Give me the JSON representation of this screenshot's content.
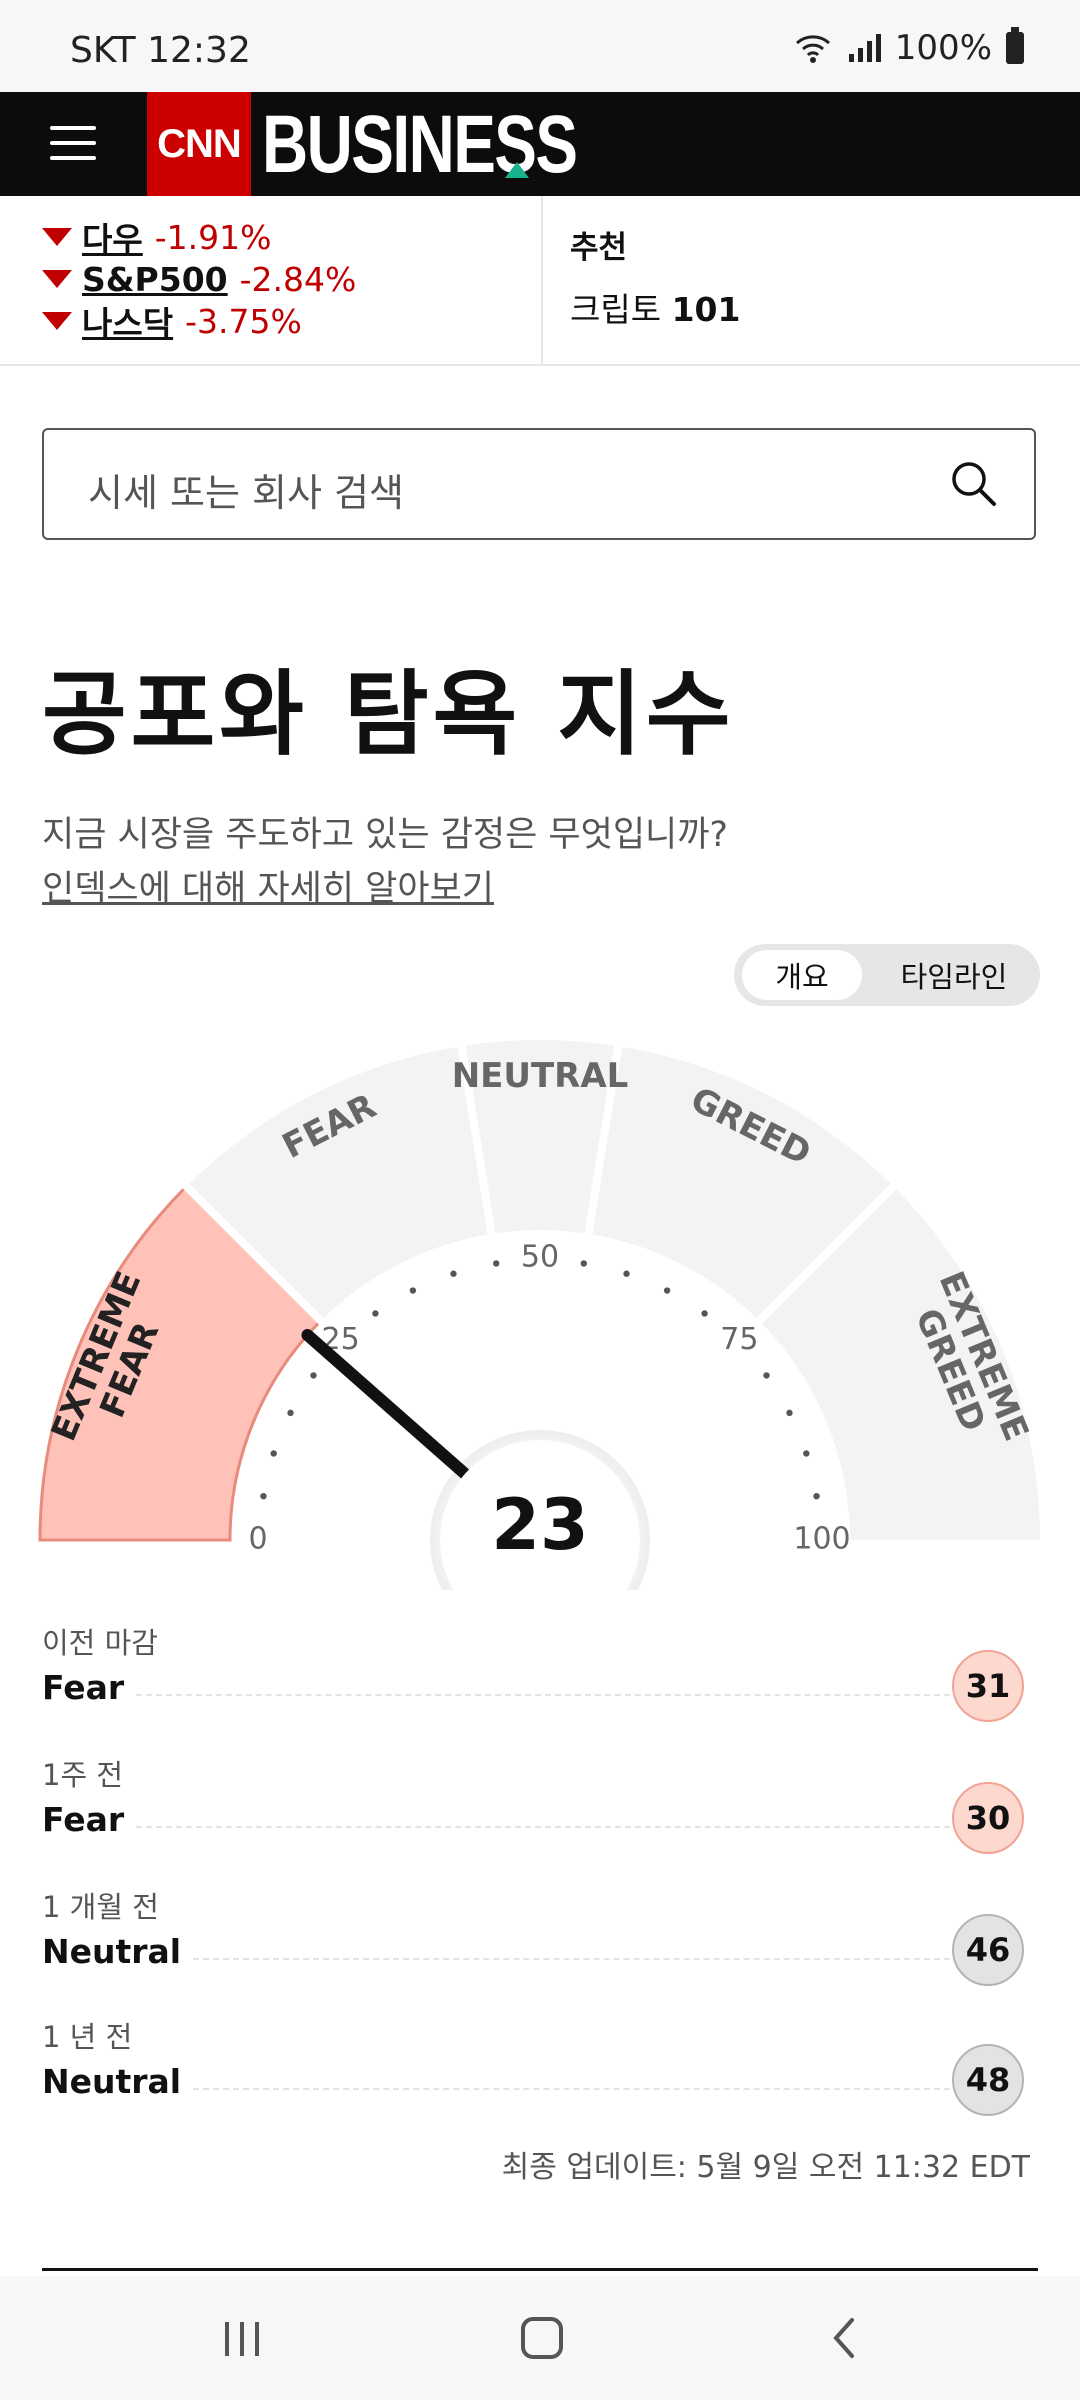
{
  "status_bar": {
    "carrier": "SKT 12:32",
    "battery": "100%"
  },
  "header": {
    "brand_cnn": "CNN",
    "brand_business": "BUSINESS"
  },
  "market": {
    "indices": [
      {
        "name": "다우",
        "change": "-1.91%"
      },
      {
        "name": "S&P500",
        "change": "-2.84%"
      },
      {
        "name": "나스닥",
        "change": "-3.75%"
      }
    ],
    "recommend_title": "추천",
    "recommend_item_prefix": "크립토",
    "recommend_item_suffix": "101"
  },
  "search": {
    "placeholder": "시세 또는 회사 검색"
  },
  "page": {
    "title": "공포와 탐욕 지수",
    "subtitle": "지금 시장을 주도하고 있는 감정은 무엇입니까?",
    "link": "인덱스에 대해 자세히 알아보기"
  },
  "toggle": {
    "overview": "개요",
    "timeline": "타임라인"
  },
  "gauge": {
    "value": "23",
    "segments": [
      "EXTREME FEAR",
      "FEAR",
      "NEUTRAL",
      "GREED",
      "EXTREME GREED"
    ],
    "ticks": [
      "0",
      "25",
      "50",
      "75",
      "100"
    ]
  },
  "history": [
    {
      "label": "이전 마감",
      "sentiment": "Fear",
      "score": "31",
      "kind": "fear"
    },
    {
      "label": "1주 전",
      "sentiment": "Fear",
      "score": "30",
      "kind": "fear"
    },
    {
      "label": "1 개월 전",
      "sentiment": "Neutral",
      "score": "46",
      "kind": "neutral"
    },
    {
      "label": "1 년 전",
      "sentiment": "Neutral",
      "score": "48",
      "kind": "neutral"
    }
  ],
  "updated": "최종 업데이트: 5월 9일 오전 11:32 EDT",
  "colors": {
    "accent_red": "#cc0000",
    "fear_fill": "#ffc2b9",
    "segment_gray": "#f3f3f3"
  }
}
